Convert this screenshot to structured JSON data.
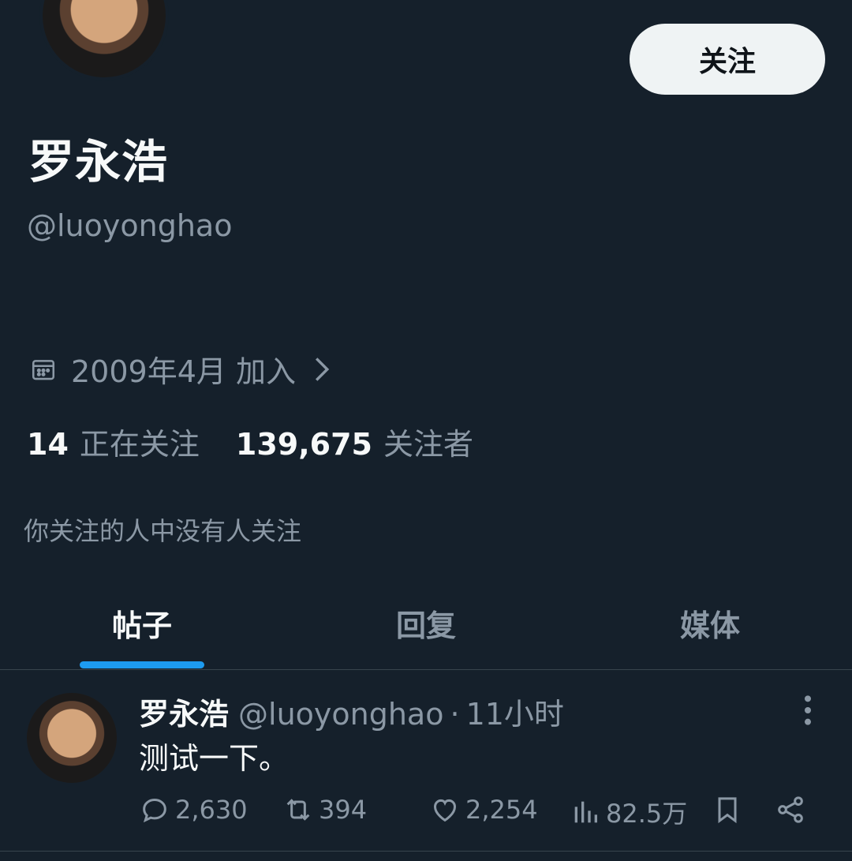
{
  "profile": {
    "display_name": "罗永浩",
    "handle": "@luoyonghao",
    "joined": "2009年4月 加入",
    "following_count": "14",
    "following_label": "正在关注",
    "followers_count": "139,675",
    "followers_label": "关注者",
    "mutual_note": "你关注的人中没有人关注",
    "follow_button": "关注"
  },
  "tabs": [
    {
      "label": "帖子",
      "active": true
    },
    {
      "label": "回复",
      "active": false
    },
    {
      "label": "媒体",
      "active": false
    }
  ],
  "post": {
    "name": "罗永浩",
    "handle": "@luoyonghao",
    "separator": "·",
    "time": "11小时",
    "text": "测试一下。",
    "replies": "2,630",
    "reposts": "394",
    "likes": "2,254",
    "views": "82.5万"
  },
  "colors": {
    "background": "#15202b",
    "accent": "#1d9bf0",
    "secondary_text": "#8b98a5",
    "divider": "#38444d"
  }
}
